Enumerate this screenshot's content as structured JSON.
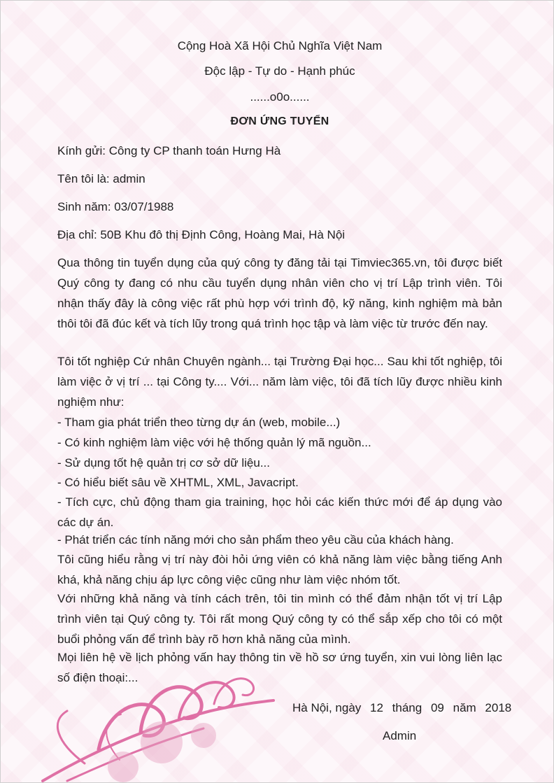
{
  "header": {
    "country": "Cộng Hoà Xã Hội Chủ Nghĩa Việt Nam",
    "motto": "Độc lập - Tự do - Hạnh phúc",
    "divider": "......o0o......",
    "title": "ĐƠN ỨNG TUYỂN"
  },
  "info": {
    "recipient": "Kính gửi: Công ty CP thanh toán Hưng Hà",
    "name": "Tên tôi là: admin",
    "birth": "Sinh năm: 03/07/1988",
    "address": "Địa chỉ: 50B Khu đô thị Định Công, Hoàng Mai, Hà Nội"
  },
  "body": {
    "intro": "Qua thông tin tuyển dụng của quý công ty đăng tải tại Timviec365.vn, tôi được biết Quý công ty đang có nhu cầu tuyển dụng nhân viên cho vị trí Lập trình viên. Tôi nhận thấy đây là công việc rất phù hợp với trình độ, kỹ năng, kinh nghiệm mà bản thôi tôi đã đúc kết và tích lũy trong quá trình học tập và làm việc từ trước đến nay.",
    "education": "Tôi tốt nghiệp Cứ nhân Chuyên ngành... tại Trường Đại học... Sau khi tốt nghiệp, tôi làm việc ở vị trí ... tại Công ty.... Với... năm làm việc, tôi đã tích lũy được nhiều kinh nghiệm như:",
    "bullets": [
      "- Tham gia phát triển theo từng dự án (web, mobile...)",
      "- Có kinh nghiệm làm việc với hệ thống quản lý mã nguồn...",
      "- Sử dụng tốt hệ quản trị cơ sở dữ liệu...",
      "- Có hiểu biết sâu về XHTML, XML, Javacript.",
      "- Tích cực, chủ động tham gia training, học hỏi các kiến thức mới để áp dụng vào các dự án.",
      "- Phát triển các tính năng mới cho sản phẩm theo yêu cầu của khách hàng."
    ],
    "english": "Tôi cũng hiểu rằng vị trí này đòi hỏi ứng viên có khả năng làm việc bằng tiếng Anh khá, khả năng chịu áp lực công việc cũng như làm việc nhóm tốt.",
    "closing": "Với những khả năng và tính cách trên, tôi tin mình có thể đảm nhận tốt vị trí Lập trình viên tại Quý công ty. Tôi rất mong Quý công ty có thể sắp xếp cho tôi có một buổi phỏng vấn để trình bày rõ hơn khả năng của mình.",
    "contact": "Mọi liên hệ về lịch phỏng vấn hay thông tin về hồ sơ ứng tuyển, xin vui lòng liên lạc số điện thoại:..."
  },
  "signature": {
    "place": "Hà Nội, ngày",
    "day": "12",
    "month_label": "tháng",
    "month": "09",
    "year_label": "năm",
    "year": "2018",
    "signer": "Admin"
  },
  "colors": {
    "accent": "#d6458a",
    "background": "#fdf7fa"
  }
}
